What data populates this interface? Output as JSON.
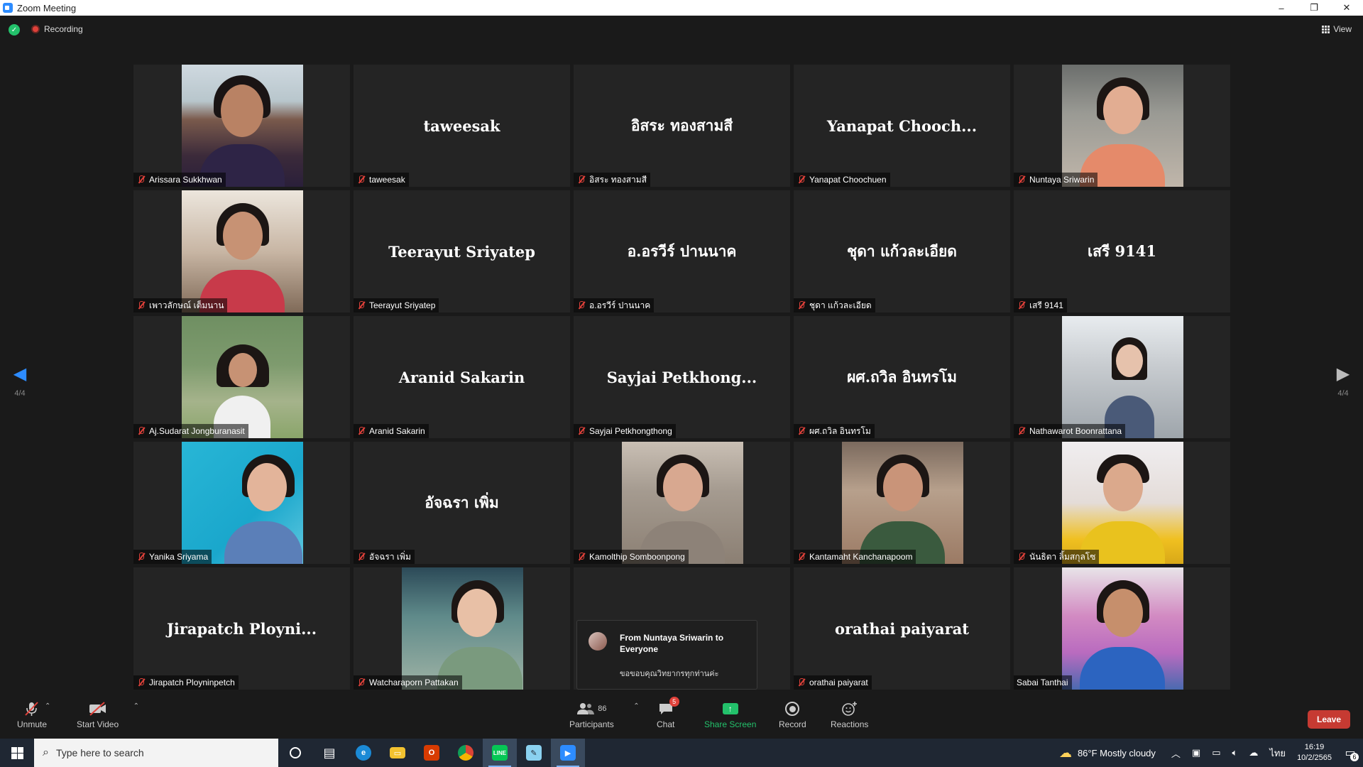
{
  "window": {
    "title": "Zoom Meeting",
    "minimize": "–",
    "restore": "❐",
    "close": "✕"
  },
  "topbar": {
    "recording_label": "Recording",
    "view_label": "View"
  },
  "tiles": [
    {
      "label": "Arissara Sukkhwan",
      "display": "",
      "has_video": true
    },
    {
      "label": "taweesak",
      "display": "taweesak",
      "has_video": false
    },
    {
      "label": "อิสระ ทองสามสี",
      "display": "อิสระ ทองสามสี",
      "has_video": false
    },
    {
      "label": "Yanapat Choochuen",
      "display": "Yanapat  Chooch...",
      "has_video": false
    },
    {
      "label": "Nuntaya Sriwarin",
      "display": "",
      "has_video": true
    },
    {
      "label": "เพาวลักษณ์ เต็มนาน",
      "display": "",
      "has_video": true
    },
    {
      "label": "Teerayut Sriyatep",
      "display": "Teerayut Sriyatep",
      "has_video": false
    },
    {
      "label": "อ.อรวีร์ ปานนาค",
      "display": "อ.อรวีร์ ปานนาค",
      "has_video": false
    },
    {
      "label": "ชุดา แก้วละเอียด",
      "display": "ชุดา แก้วละเอียด",
      "has_video": false
    },
    {
      "label": "เสรี 9141",
      "display": "เสรี 9141",
      "has_video": false
    },
    {
      "label": "Aj.Sudarat Jongburanasit",
      "display": "",
      "has_video": true
    },
    {
      "label": "Aranid Sakarin",
      "display": "Aranid Sakarin",
      "has_video": false
    },
    {
      "label": "Sayjai Petkhongthong",
      "display": "Sayjai  Petkhong...",
      "has_video": false
    },
    {
      "label": "ผศ.ถวิล อินทรโม",
      "display": "ผศ.ถวิล อินทรโม",
      "has_video": false
    },
    {
      "label": "Nathawarot Boonrattana",
      "display": "",
      "has_video": true
    },
    {
      "label": "Yanika Sriyama",
      "display": "",
      "has_video": true
    },
    {
      "label": "อัจฉรา เพิ่ม",
      "display": "อัจฉรา เพิ่ม",
      "has_video": false
    },
    {
      "label": "Kamolthip Somboonpong",
      "display": "",
      "has_video": true
    },
    {
      "label": "Kantamaht Kanchanapoom",
      "display": "",
      "has_video": true
    },
    {
      "label": "นันธิตา ลิ้มสกุลโซ",
      "display": "",
      "has_video": true
    },
    {
      "label": "Jirapatch Ployninpetch",
      "display": "Jirapatch  Ployni...",
      "has_video": false
    },
    {
      "label": "Watcharaporn Pattakan",
      "display": "",
      "has_video": true
    },
    {
      "label": "",
      "display": "",
      "has_video": false
    },
    {
      "label": "orathai paiyarat",
      "display": "orathai paiyarat",
      "has_video": false
    },
    {
      "label": "Sabai Tanthai",
      "display": "",
      "has_video": true
    }
  ],
  "chat_popup": {
    "from": "From Nuntaya Sriwarin to Everyone",
    "message": "ขอขอบคุณวิทยากรทุกท่านค่ะ"
  },
  "pagination": {
    "prev": "4/4",
    "next": "4/4"
  },
  "toolbar": {
    "unmute": "Unmute",
    "start_video": "Start Video",
    "participants": "Participants",
    "participants_count": "86",
    "chat": "Chat",
    "chat_badge": "5",
    "share_screen": "Share Screen",
    "record": "Record",
    "reactions": "Reactions",
    "leave": "Leave"
  },
  "taskbar": {
    "search_placeholder": "Type here to search",
    "weather": "86°F  Mostly cloudy",
    "language": "ไทย",
    "time": "16:19",
    "date": "10/2/2565",
    "notifications": "6"
  },
  "colors": {
    "accent": "#2d8cff",
    "share_green": "#23c16b",
    "leave_red": "#c63a32",
    "mute_red": "#e0413a"
  }
}
